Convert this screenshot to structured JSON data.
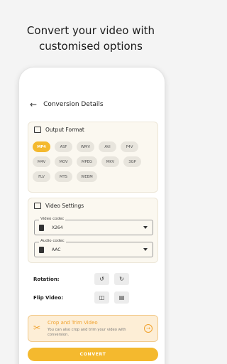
{
  "headline": {
    "line1": "Convert your video with",
    "line2": "customised options"
  },
  "appbar": {
    "title": "Conversion Details",
    "back_icon": "arrow-left-icon"
  },
  "output_format": {
    "title": "Output Format",
    "formats": [
      "MP4",
      "ASF",
      "WMV",
      "AVI",
      "F4V",
      "M4V",
      "MOV",
      "MPEG",
      "MKV",
      "3GP",
      "FLV",
      "MTS",
      "WEBM"
    ],
    "selected": "MP4"
  },
  "video_settings": {
    "title": "Video Settings",
    "video_codec": {
      "label": "Video codec",
      "value": "X264"
    },
    "audio_codec": {
      "label": "Audio codec",
      "value": "AAC"
    }
  },
  "rotation": {
    "label": "Rotation:"
  },
  "flip": {
    "label": "Flip Video:"
  },
  "trim": {
    "title": "Crop and Trim Video",
    "description": "You can also crop and trim your video with conversion."
  },
  "convert_button": {
    "label": "CONVERT"
  },
  "colors": {
    "accent": "#f4b92e",
    "trim_bg": "#fdeed6",
    "card_bg": "#fbf8f0"
  }
}
